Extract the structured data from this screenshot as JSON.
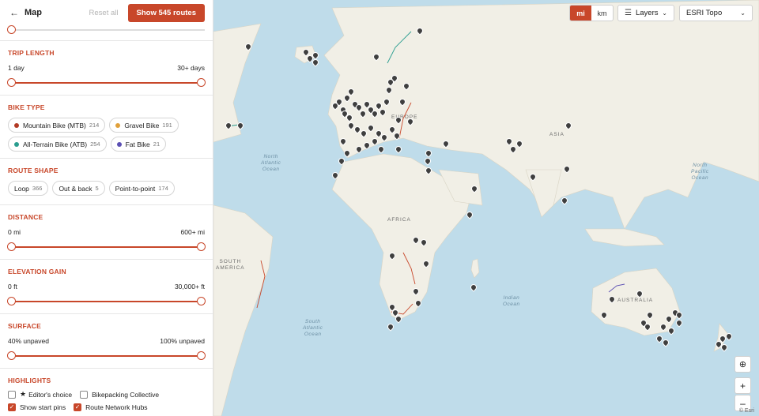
{
  "header": {
    "back_icon": "arrow-left-icon",
    "title": "Map",
    "reset_label": "Reset all",
    "show_label": "Show 545 routes"
  },
  "filters": {
    "trip_length": {
      "title": "TRIP LENGTH",
      "min_label": "1 day",
      "max_label": "30+ days"
    },
    "bike_type": {
      "title": "BIKE TYPE",
      "chips": [
        {
          "label": "Mountain Bike (MTB)",
          "count": "214",
          "color": "#b23a25"
        },
        {
          "label": "Gravel Bike",
          "count": "191",
          "color": "#e0a03a"
        },
        {
          "label": "All-Terrain Bike (ATB)",
          "count": "254",
          "color": "#2a9d8f"
        },
        {
          "label": "Fat Bike",
          "count": "21",
          "color": "#5b4fb3"
        }
      ]
    },
    "route_shape": {
      "title": "ROUTE SHAPE",
      "chips": [
        {
          "label": "Loop",
          "count": "366"
        },
        {
          "label": "Out & back",
          "count": "5"
        },
        {
          "label": "Point-to-point",
          "count": "174"
        }
      ]
    },
    "distance": {
      "title": "DISTANCE",
      "min_label": "0 mi",
      "max_label": "600+ mi"
    },
    "elevation": {
      "title": "ELEVATION GAIN",
      "min_label": "0 ft",
      "max_label": "30,000+ ft"
    },
    "surface": {
      "title": "SURFACE",
      "min_label": "40% unpaved",
      "max_label": "100% unpaved"
    },
    "highlights": {
      "title": "HIGHLIGHTS",
      "items": [
        {
          "label": "Editor's choice",
          "checked": false,
          "icon": "star-icon"
        },
        {
          "label": "Bikepacking Collective",
          "checked": false
        },
        {
          "label": "Show start pins",
          "checked": true
        },
        {
          "label": "Route Network Hubs",
          "checked": true
        }
      ]
    }
  },
  "map": {
    "units": {
      "mi": "mi",
      "km": "km",
      "active": "mi"
    },
    "layers_label": "Layers",
    "basemap_label": "ESRI Topo",
    "zoom_in": "+",
    "zoom_out": "–",
    "attribution": "© Esri",
    "labels": {
      "europe": "EUROPE",
      "africa": "AFRICA",
      "asia": "ASIA",
      "australia": "AUSTRALIA",
      "south_america": "SOUTH\nAMERICA",
      "north_atlantic": "North\nAtlantic\nOcean",
      "south_atlantic": "South\nAtlantic\nOcean",
      "indian": "Indian\nOcean",
      "north_pacific": "North\nPacific\nOcean"
    },
    "accent": "#c8472a"
  }
}
